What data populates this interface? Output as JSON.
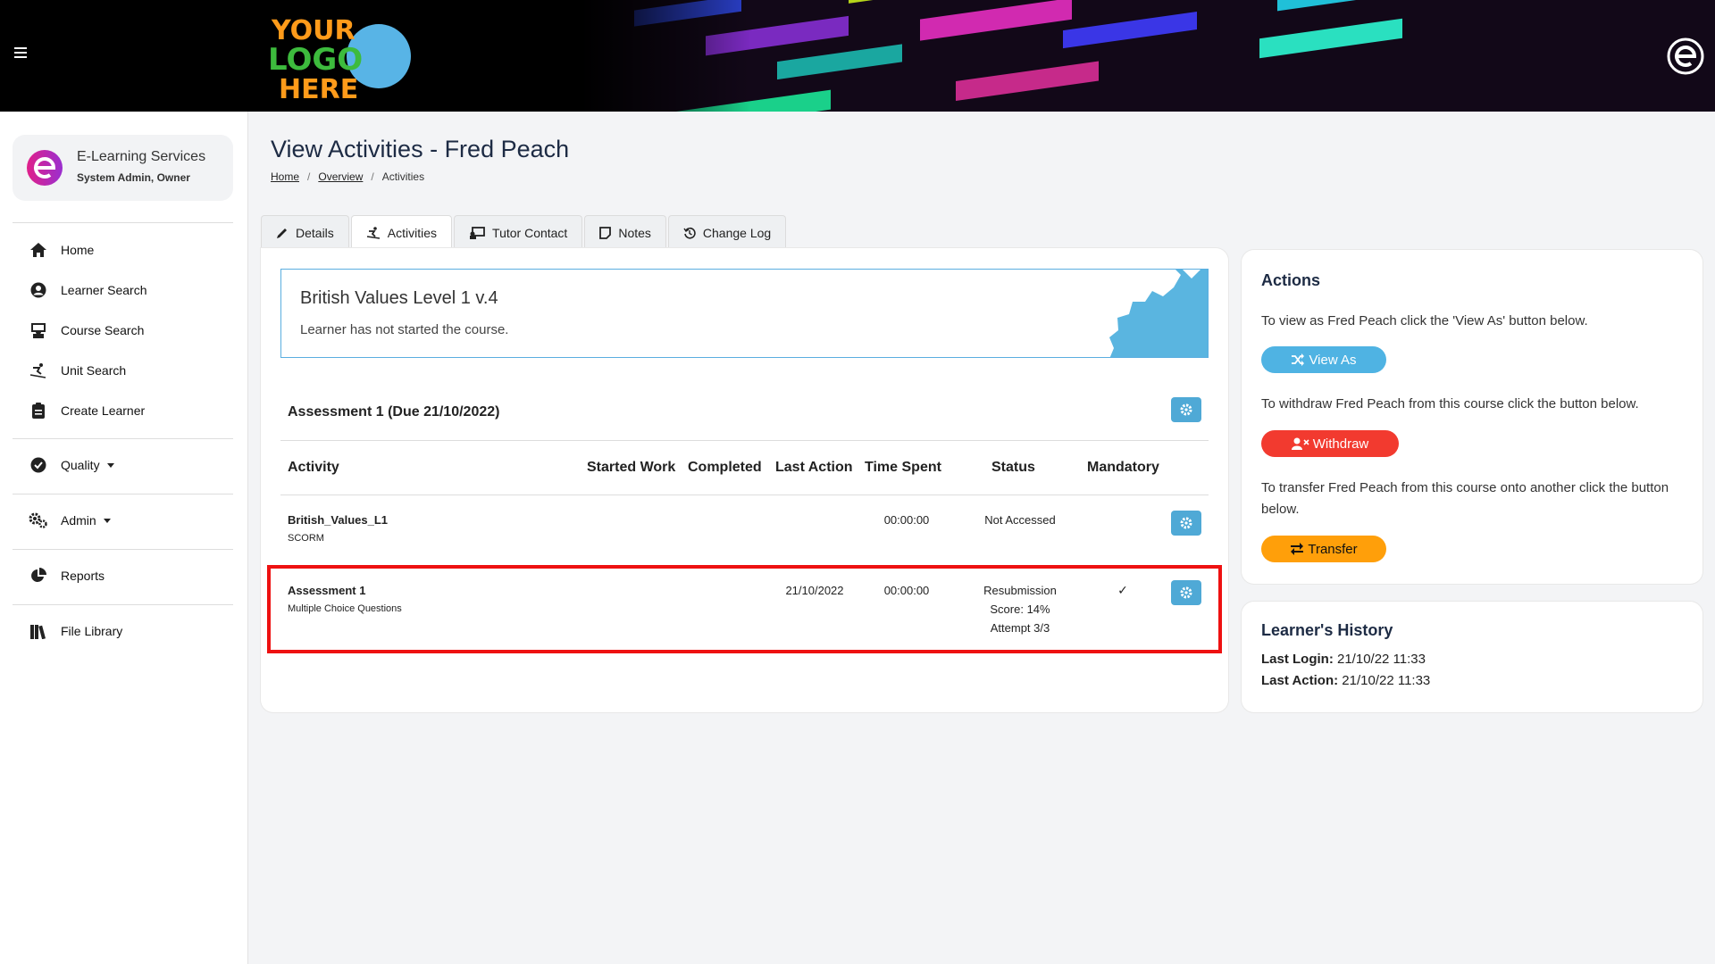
{
  "header": {
    "logo_text": [
      "YOUR",
      "LOGO",
      "HERE"
    ]
  },
  "sidebar": {
    "profile": {
      "org": "E-Learning Services",
      "role": "System Admin, Owner"
    },
    "items": [
      {
        "label": "Home",
        "icon": "home-icon"
      },
      {
        "label": "Learner Search",
        "icon": "user-circle-icon"
      },
      {
        "label": "Course Search",
        "icon": "teacher-icon"
      },
      {
        "label": "Unit Search",
        "icon": "skier-icon"
      },
      {
        "label": "Create Learner",
        "icon": "clipboard-icon"
      },
      {
        "label": "Quality",
        "icon": "check-circle-icon",
        "dropdown": true
      },
      {
        "label": "Admin",
        "icon": "gears-icon",
        "dropdown": true
      },
      {
        "label": "Reports",
        "icon": "pie-chart-icon"
      },
      {
        "label": "File Library",
        "icon": "books-icon"
      }
    ]
  },
  "page": {
    "title": "View Activities - Fred Peach",
    "breadcrumb": [
      "Home",
      "Overview",
      "Activities"
    ]
  },
  "tabs": [
    {
      "label": "Details",
      "icon": "pencil-icon"
    },
    {
      "label": "Activities",
      "icon": "skier-icon",
      "active": true
    },
    {
      "label": "Tutor Contact",
      "icon": "chalkboard-icon"
    },
    {
      "label": "Notes",
      "icon": "note-icon"
    },
    {
      "label": "Change Log",
      "icon": "history-icon"
    }
  ],
  "course": {
    "title": "British Values Level 1 v.4",
    "status": "Learner has not started the course."
  },
  "assessment": {
    "title": "Assessment 1 (Due 21/10/2022)",
    "columns": [
      "Activity",
      "Started Work",
      "Completed",
      "Last Action",
      "Time Spent",
      "Status",
      "Mandatory"
    ],
    "rows": [
      {
        "name": "British_Values_L1",
        "type": "SCORM",
        "started": "",
        "completed": "",
        "last_action": "",
        "time_spent": "00:00:00",
        "status": [
          "Not Accessed"
        ],
        "mandatory": ""
      },
      {
        "name": "Assessment 1",
        "type": "Multiple Choice Questions",
        "started": "",
        "completed": "",
        "last_action": "21/10/2022",
        "time_spent": "00:00:00",
        "status": [
          "Resubmission",
          "Score: 14%",
          "Attempt 3/3"
        ],
        "mandatory": "✓"
      }
    ]
  },
  "actions": {
    "title": "Actions",
    "view_text": "To view as Fred Peach click the 'View As' button below.",
    "view_label": "View As",
    "withdraw_text": "To withdraw Fred Peach from this course click the button below.",
    "withdraw_label": "Withdraw",
    "transfer_text": "To transfer Fred Peach from this course onto another click the button below.",
    "transfer_label": "Transfer"
  },
  "history": {
    "title": "Learner's History",
    "last_login_label": "Last Login:",
    "last_login": "21/10/22 11:33",
    "last_action_label": "Last Action:",
    "last_action": "21/10/22 11:33"
  },
  "colors": {
    "accent": "#4fa9d6",
    "view_as": "#4fb3e3",
    "withdraw": "#f23a2f",
    "transfer": "#ff9f0a",
    "highlight": "#ee1111"
  }
}
